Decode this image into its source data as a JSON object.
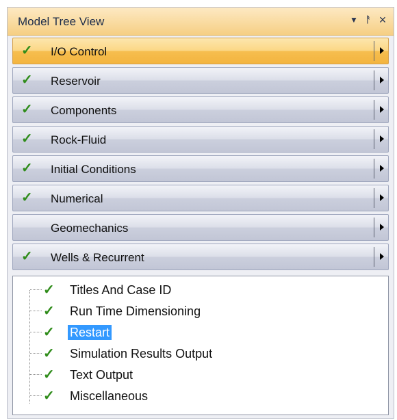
{
  "panel": {
    "title": "Model Tree View",
    "controls": {
      "dropdown_icon": "chevron-down-icon",
      "pin_icon": "pin-icon",
      "close_icon": "close-icon"
    }
  },
  "sections": [
    {
      "label": "I/O Control",
      "checked": true,
      "active": true
    },
    {
      "label": "Reservoir",
      "checked": true,
      "active": false
    },
    {
      "label": "Components",
      "checked": true,
      "active": false
    },
    {
      "label": "Rock-Fluid",
      "checked": true,
      "active": false
    },
    {
      "label": "Initial Conditions",
      "checked": true,
      "active": false
    },
    {
      "label": "Numerical",
      "checked": true,
      "active": false
    },
    {
      "label": "Geomechanics",
      "checked": false,
      "active": false
    },
    {
      "label": "Wells & Recurrent",
      "checked": true,
      "active": false
    }
  ],
  "tree": {
    "items": [
      {
        "label": "Titles And Case ID",
        "checked": true,
        "selected": false
      },
      {
        "label": "Run Time Dimensioning",
        "checked": true,
        "selected": false
      },
      {
        "label": "Restart",
        "checked": true,
        "selected": true
      },
      {
        "label": "Simulation Results Output",
        "checked": true,
        "selected": false
      },
      {
        "label": "Text Output",
        "checked": true,
        "selected": false
      },
      {
        "label": "Miscellaneous",
        "checked": true,
        "selected": false
      }
    ]
  },
  "colors": {
    "titlebar": "#f6cf84",
    "active_section": "#f6be4f",
    "section": "#cbcfdd",
    "check": "#2f8c1a",
    "selection": "#3399ff"
  }
}
